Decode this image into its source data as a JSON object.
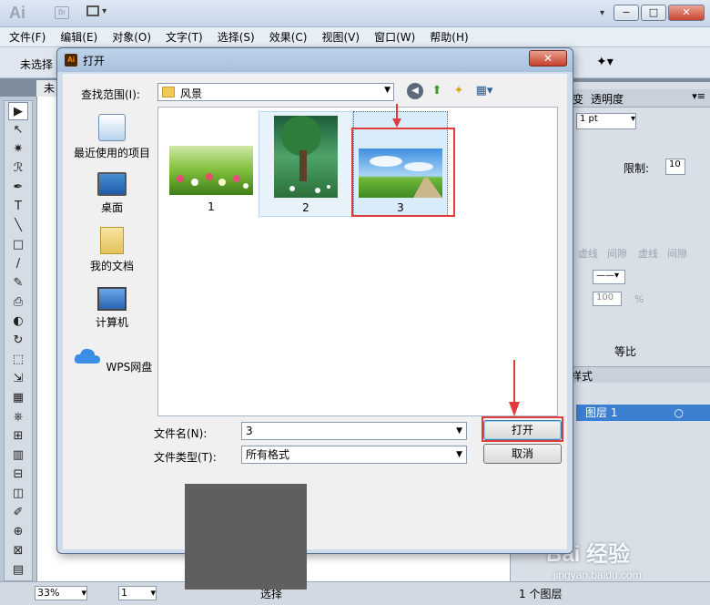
{
  "app": {
    "logo": "Ai",
    "bridge_label": "Br",
    "window_controls": [
      "−",
      "□",
      "✕"
    ],
    "menus": [
      "文件(F)",
      "编辑(E)",
      "对象(O)",
      "文字(T)",
      "选择(S)",
      "效果(C)",
      "视图(V)",
      "窗口(W)",
      "帮助(H)"
    ],
    "control_label": "未选择",
    "doc_tab": "未",
    "tools": [
      "▶",
      "↖",
      "✷",
      "ℛ",
      "✒",
      "T",
      "╲",
      "□",
      "/",
      "✎",
      "⎙",
      "◐",
      "↻",
      "⬚",
      "⇲",
      "▦",
      "⎈",
      "⊞",
      "▥",
      "⊟",
      "◫",
      "✐",
      "⊕",
      "⊠",
      "▤"
    ]
  },
  "right_panel": {
    "tabs": [
      "变",
      "透明度"
    ],
    "stroke_weight": "1 pt",
    "limit_label": "限制:",
    "limit_value": "10",
    "dash_labels": [
      "虚线",
      "间隙",
      "虚线",
      "间隙"
    ],
    "scale_value": "100",
    "pct": "%",
    "ratio_label": "等比",
    "tab_bottom": "样式",
    "layer_name": "图层 1"
  },
  "status": {
    "zoom": "33%",
    "page": "1",
    "tool_label": "选择",
    "layers_count": "1 个图层"
  },
  "watermark": {
    "main": "Bai 经验",
    "sub": "jingyan.baidu.com"
  },
  "dialog": {
    "title_icon": "Ai",
    "title": "打开",
    "close": "✕",
    "lookin_label": "查找范围(I):",
    "lookin_value": "风景",
    "places": [
      {
        "label": "最近使用的项目",
        "icon": "recent-places-icon"
      },
      {
        "label": "桌面",
        "icon": "desktop-icon"
      },
      {
        "label": "我的文档",
        "icon": "my-documents-icon"
      },
      {
        "label": "计算机",
        "icon": "computer-icon"
      },
      {
        "label": "WPS网盘",
        "icon": "wps-cloud-icon"
      }
    ],
    "files": [
      {
        "label": "1"
      },
      {
        "label": "2"
      },
      {
        "label": "3"
      }
    ],
    "filename_label": "文件名(N):",
    "filename_value": "3",
    "filetype_label": "文件类型(T):",
    "filetype_value": "所有格式",
    "open_button": "打开",
    "cancel_button": "取消"
  },
  "colors": {
    "annotation_red": "#e03c3c",
    "selection_blue": "#3b7fd1"
  }
}
